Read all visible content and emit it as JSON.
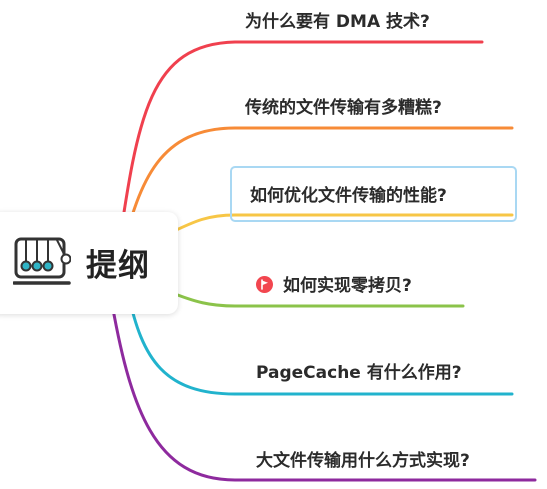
{
  "root": {
    "title": "提纲",
    "icon": "newtons-cradle-icon"
  },
  "branches": [
    {
      "label": "为什么要有 DMA 技术?",
      "color": "#f0404e"
    },
    {
      "label": "传统的文件传输有多糟糕?",
      "color": "#f78b37"
    },
    {
      "label": "如何优化文件传输的性能?",
      "color": "#f7c646",
      "selected": true
    },
    {
      "label": "如何实现零拷贝?",
      "color": "#8bc34a",
      "marker": "red-flag-icon"
    },
    {
      "label": "PageCache 有什么作用?",
      "color": "#21b3cd"
    },
    {
      "label": "大文件传输用什么方式实现?",
      "color": "#8e2a9e"
    }
  ],
  "colors": {
    "selection_border": "#a9d8f3",
    "flag_red": "#f2464f"
  }
}
